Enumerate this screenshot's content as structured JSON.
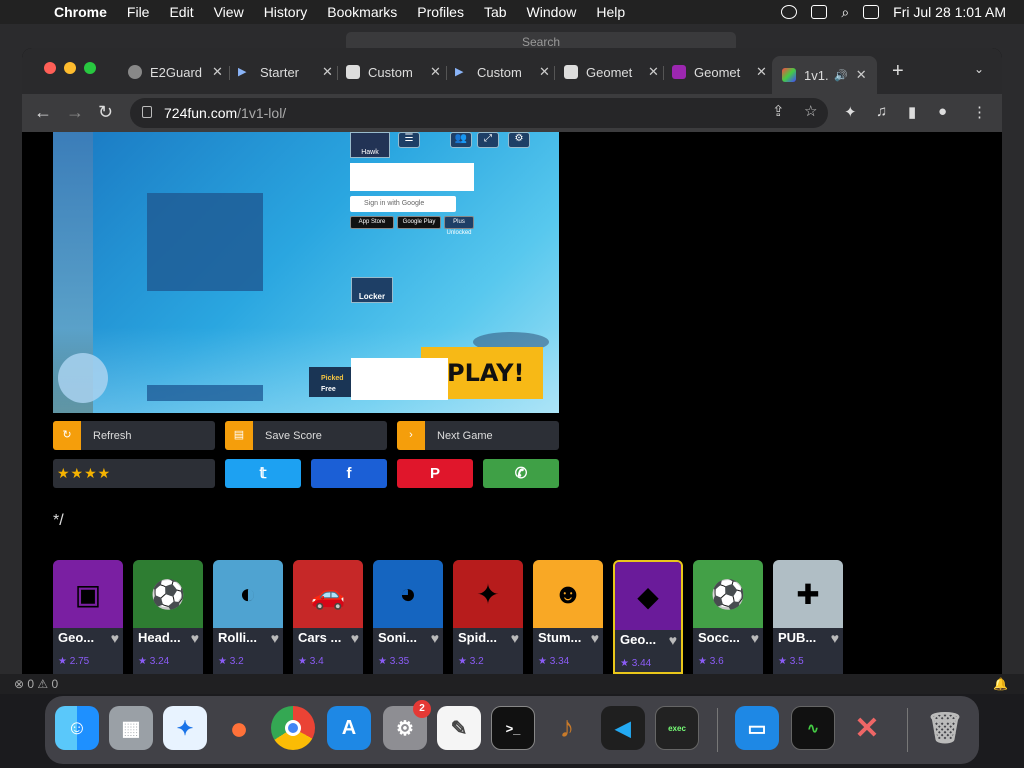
{
  "menubar": {
    "app": "Chrome",
    "items": [
      "File",
      "Edit",
      "View",
      "History",
      "Bookmarks",
      "Profiles",
      "Tab",
      "Window",
      "Help"
    ],
    "clock": "Fri Jul 28  1:01 AM"
  },
  "vscode": {
    "search_placeholder": "Search",
    "status_errors": "0",
    "status_warnings": "0"
  },
  "tabs": [
    {
      "title": "E2Guard",
      "icon": "globe-icon"
    },
    {
      "title": "Starter",
      "icon": "play-icon"
    },
    {
      "title": "Custom",
      "icon": "roblox-icon"
    },
    {
      "title": "Custom",
      "icon": "play-icon"
    },
    {
      "title": "Geomet",
      "icon": "roblox-icon"
    },
    {
      "title": "Geomet",
      "icon": "geometry-dash-icon"
    },
    {
      "title": "1v1.",
      "icon": "game-icon"
    }
  ],
  "address": {
    "domain": "724fun.com",
    "path": "/1v1-lol/"
  },
  "game": {
    "player_name": "Hawk",
    "google_signin": "Sign in with Google",
    "app_store": "App Store",
    "google_play": "Google Play",
    "plus": "Plus Unlocked",
    "locker": "Locker",
    "picked_line1": "Picked",
    "picked_line2": "Free",
    "play": "PLAY!"
  },
  "actions": {
    "refresh": "Refresh",
    "save_score": "Save Score",
    "next_game": "Next Game"
  },
  "rating_stars": 4,
  "stray_text": "*/",
  "cards": [
    {
      "name": "Geo...",
      "rating": "2.75",
      "color": "#7a1fa2"
    },
    {
      "name": "Head...",
      "rating": "3.24",
      "color": "#2e7d32"
    },
    {
      "name": "Rolli...",
      "rating": "3.2",
      "color": "#4fa3d1"
    },
    {
      "name": "Cars ...",
      "rating": "3.4",
      "color": "#c62828"
    },
    {
      "name": "Soni...",
      "rating": "3.35",
      "color": "#1565c0"
    },
    {
      "name": "Spid...",
      "rating": "3.2",
      "color": "#b71c1c"
    },
    {
      "name": "Stum...",
      "rating": "3.34",
      "color": "#f9a825"
    },
    {
      "name": "Geo...",
      "rating": "3.44",
      "color": "#6a1b9a"
    },
    {
      "name": "Socc...",
      "rating": "3.6",
      "color": "#43a047"
    },
    {
      "name": "PUB...",
      "rating": "3.5",
      "color": "#b0bec5"
    }
  ],
  "dock": {
    "settings_badge": "2"
  }
}
